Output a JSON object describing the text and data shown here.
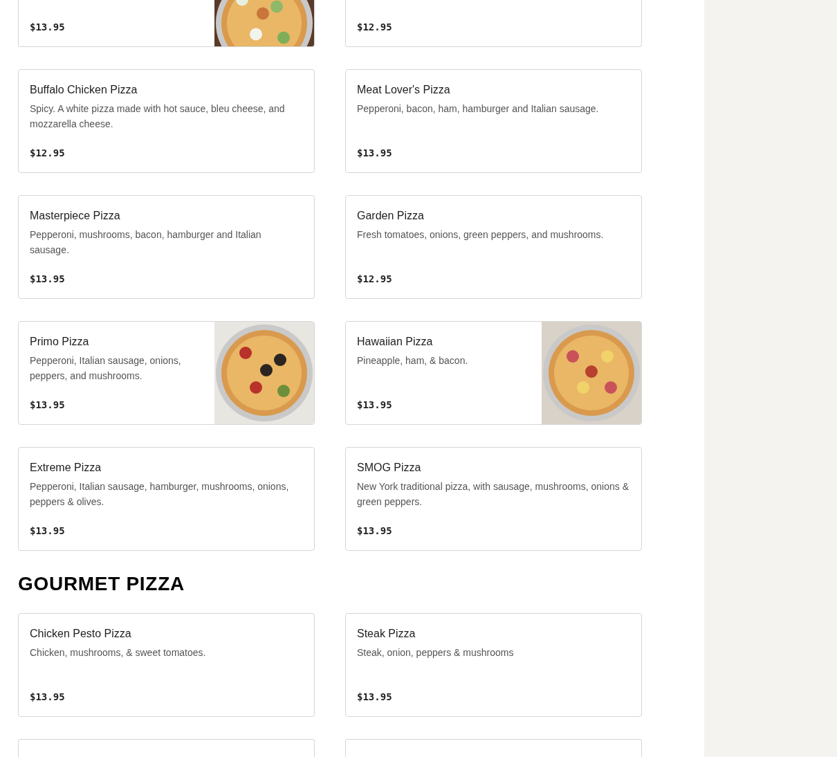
{
  "sections": [
    {
      "items": [
        {
          "price": "$13.95",
          "has_picture": true
        },
        {
          "price": "$12.95",
          "has_picture": false
        },
        {
          "name": "Buffalo Chicken Pizza",
          "description": "Spicy. A white pizza made with hot sauce, bleu cheese, and mozzarella cheese.",
          "price": "$12.95",
          "has_picture": false
        },
        {
          "name": "Meat Lover's Pizza",
          "description": "Pepperoni, bacon, ham, hamburger and Italian sausage.",
          "price": "$13.95",
          "has_picture": false
        },
        {
          "name": "Masterpiece Pizza",
          "description": "Pepperoni, mushrooms, bacon, hamburger and Italian sausage.",
          "price": "$13.95",
          "has_picture": false
        },
        {
          "name": "Garden Pizza",
          "description": "Fresh tomatoes, onions, green peppers, and mushrooms.",
          "price": "$12.95",
          "has_picture": false
        },
        {
          "name": "Primo Pizza",
          "description": "Pepperoni, Italian sausage, onions, peppers, and mushrooms.",
          "price": "$13.95",
          "has_picture": true
        },
        {
          "name": "Hawaiian Pizza",
          "description": "Pineapple, ham, & bacon.",
          "price": "$13.95",
          "has_picture": true
        },
        {
          "name": "Extreme Pizza",
          "description": "Pepperoni, Italian sausage, hamburger, mushrooms, onions, peppers & olives.",
          "price": "$13.95",
          "has_picture": false
        },
        {
          "name": "SMOG Pizza",
          "description": "New York traditional pizza, with sausage, mushrooms, onions & green peppers.",
          "price": "$13.95",
          "has_picture": false
        }
      ]
    },
    {
      "heading": "GOURMET PIZZA",
      "items": [
        {
          "name": "Chicken Pesto Pizza",
          "description": "Chicken, mushrooms, & sweet tomatoes.",
          "price": "$13.95",
          "has_picture": false
        },
        {
          "name": "Steak Pizza",
          "description": "Steak, onion, peppers & mushrooms",
          "price": "$13.95",
          "has_picture": false
        },
        {
          "has_picture": false
        },
        {
          "has_picture": false
        }
      ]
    }
  ]
}
